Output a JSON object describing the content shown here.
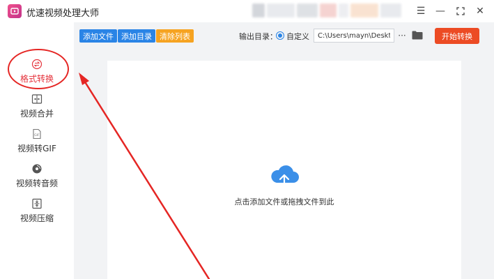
{
  "app": {
    "title": "优速视频处理大师",
    "icon": "video-app-logo-icon"
  },
  "window_controls": [
    {
      "name": "menu-icon",
      "glyph": "☰"
    },
    {
      "name": "minimize-icon",
      "glyph": "—"
    },
    {
      "name": "maximize-icon",
      "glyph": "⛶"
    },
    {
      "name": "close-icon",
      "glyph": "✕"
    }
  ],
  "sidebar": {
    "items": [
      {
        "label": "格式转换",
        "icon": "format-convert-icon",
        "active": true
      },
      {
        "label": "视频合并",
        "icon": "video-merge-icon",
        "active": false
      },
      {
        "label": "视频转GIF",
        "icon": "gif-icon",
        "active": false
      },
      {
        "label": "视频转音频",
        "icon": "audio-disc-icon",
        "active": false
      },
      {
        "label": "视频压缩",
        "icon": "compress-icon",
        "active": false
      }
    ]
  },
  "toolbar": {
    "add_file_label": "添加文件",
    "add_dir_label": "添加目录",
    "clear_list_label": "清除列表",
    "output_dir_label": "输出目录：",
    "custom_radio_label": "自定义",
    "output_path_value": "C:\\Users\\mayn\\Desktop",
    "more_label": "···",
    "start_label": "开始转换"
  },
  "main": {
    "drop_hint": "点击添加文件或拖拽文件到此"
  },
  "colors": {
    "accent_blue": "#2a84e6",
    "accent_orange": "#f6a321",
    "start_red": "#ec4b24",
    "annotation_red": "#e52624"
  }
}
